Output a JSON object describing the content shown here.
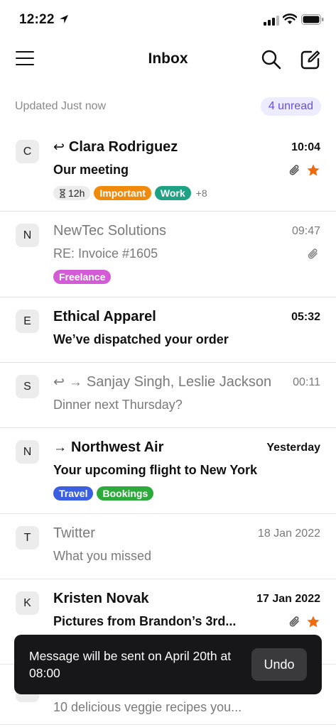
{
  "status": {
    "time": "12:22"
  },
  "header": {
    "title": "Inbox"
  },
  "subheader": {
    "updated": "Updated Just now",
    "unread": "4 unread"
  },
  "colors": {
    "important": "#f08a0c",
    "work": "#1fa183",
    "freelance": "#d35bd6",
    "travel": "#3a5fe0",
    "bookings": "#2eaa3d",
    "star": "#f06a0c",
    "accent": "#6b4de6"
  },
  "emails": [
    {
      "initial": "C",
      "sender": "Clara Rodriguez",
      "time": "10:04",
      "subject": "Our meeting",
      "snooze": "12h",
      "tags": [
        "Important",
        "Work"
      ],
      "more": "+8"
    },
    {
      "initial": "N",
      "sender": "NewTec Solutions",
      "time": "09:47",
      "subject": "RE: Invoice #1605",
      "tags": [
        "Freelance"
      ]
    },
    {
      "initial": "E",
      "sender": "Ethical Apparel",
      "time": "05:32",
      "subject": "We’ve dispatched your order"
    },
    {
      "initial": "S",
      "sender": "Sanjay Singh, Leslie Jackson",
      "time": "00:11",
      "subject": "Dinner next Thursday?"
    },
    {
      "initial": "N",
      "sender": "Northwest Air",
      "time": "Yesterday",
      "subject": "Your upcoming flight to New York",
      "tags": [
        "Travel",
        "Bookings"
      ]
    },
    {
      "initial": "T",
      "sender": "Twitter",
      "time": "18 Jan 2022",
      "subject": "What you missed"
    },
    {
      "initial": "K",
      "sender": "Kristen Novak",
      "time": "17 Jan 2022",
      "subject": "Pictures from Brandon’s 3rd..."
    },
    {
      "subject": "10 delicious veggie recipes you..."
    }
  ],
  "toast": {
    "message": "Message will be sent on April 20th at 08:00",
    "action": "Undo"
  }
}
